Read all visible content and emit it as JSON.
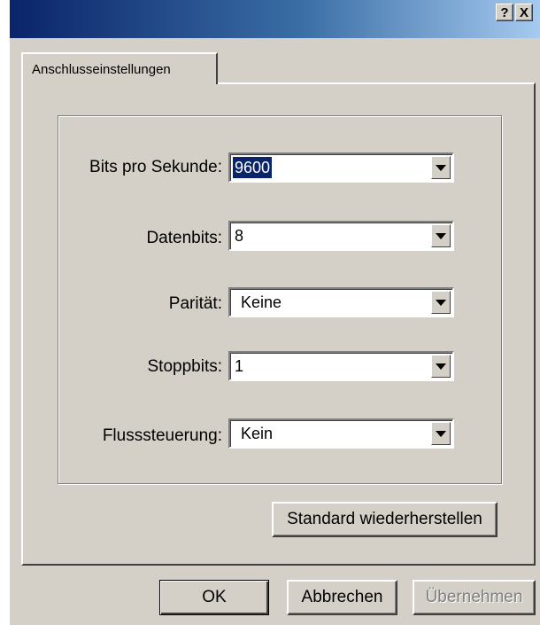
{
  "titlebar": {
    "help_glyph": "?",
    "close_glyph": "X"
  },
  "tabs": [
    {
      "label": "Anschlusseinstellungen"
    }
  ],
  "fields": [
    {
      "label": "Bits pro Sekunde:",
      "value": "9600",
      "selected": true
    },
    {
      "label": "Datenbits:",
      "value": "8"
    },
    {
      "label": "Parität:",
      "value": "Keine"
    },
    {
      "label": "Stoppbits:",
      "value": "1"
    },
    {
      "label": "Flusssteuerung:",
      "value": "Kein"
    }
  ],
  "buttons": {
    "restore_defaults": "Standard wiederherstellen",
    "ok": "OK",
    "cancel": "Abbrechen",
    "apply": "Übernehmen"
  },
  "colors": {
    "selection": "#0a246a",
    "face": "#d4d0c8",
    "title_gradient_start": "#0a246a"
  }
}
